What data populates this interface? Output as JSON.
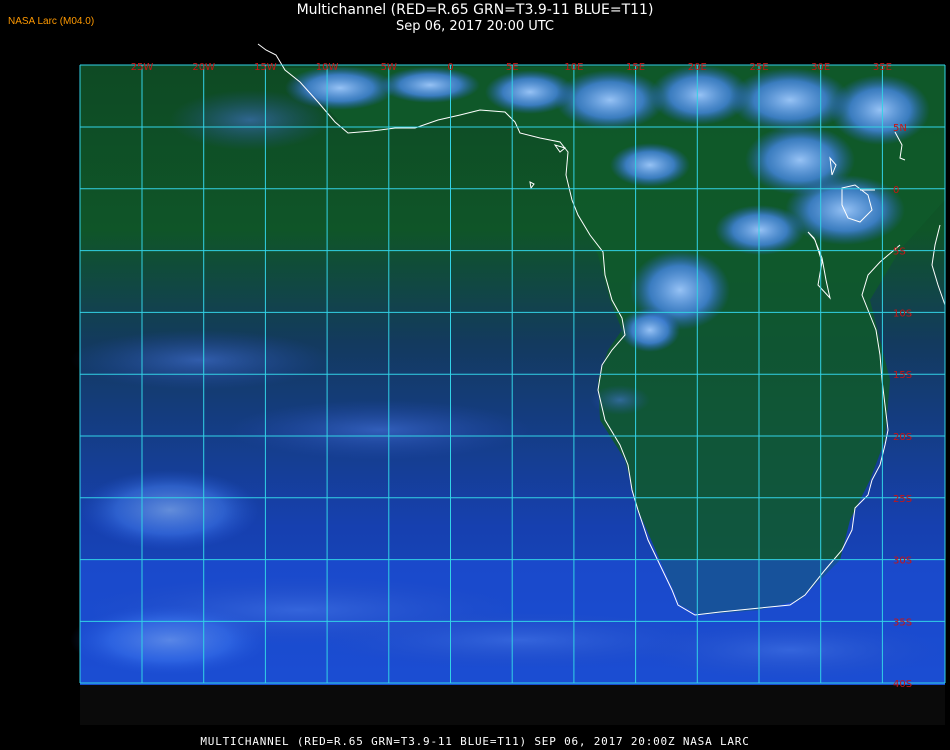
{
  "header": {
    "title": "Multichannel (RED=R.65 GRN=T3.9-11 BLUE=T11)",
    "datetime": "Sep 06, 2017 20:00 UTC",
    "badge": "NASA Larc (M04.0)"
  },
  "footer": {
    "text": "MULTICHANNEL (RED=R.65 GRN=T3.9-11 BLUE=T11) SEP 06, 2017 20:00Z   NASA LARC"
  },
  "map": {
    "lon_labels": [
      "25W",
      "20W",
      "15W",
      "10W",
      "5W",
      "0",
      "5E",
      "10E",
      "15E",
      "20E",
      "25E",
      "30E",
      "35E"
    ],
    "lat_labels": [
      "5N",
      "0",
      "5S",
      "10S",
      "15S",
      "20S",
      "25S",
      "30S",
      "35S",
      "40S"
    ],
    "grid_color": "#32d2e6",
    "label_color": "#c81414",
    "coast_color": "#ffffff"
  }
}
